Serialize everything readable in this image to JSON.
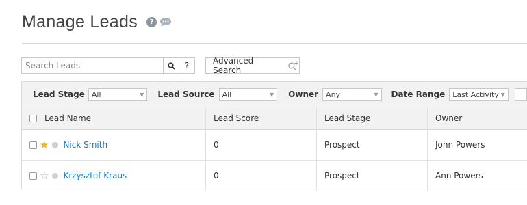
{
  "header": {
    "title": "Manage Leads",
    "help_glyph": "?"
  },
  "search": {
    "placeholder": "Search Leads",
    "value": "",
    "help_label": "?"
  },
  "advanced_search": {
    "label": "Advanced Search"
  },
  "filters": [
    {
      "label": "Lead Stage",
      "value": "All"
    },
    {
      "label": "Lead Source",
      "value": "All"
    },
    {
      "label": "Owner",
      "value": "Any"
    },
    {
      "label": "Date Range",
      "value": "Last Activity"
    }
  ],
  "table": {
    "columns": [
      "Lead Name",
      "Lead Score",
      "Lead Stage",
      "Owner"
    ],
    "rows": [
      {
        "name": "Nick Smith",
        "starred": true,
        "score": "0",
        "stage": "Prospect",
        "owner": "John Powers"
      },
      {
        "name": "Krzysztof Kraus",
        "starred": false,
        "score": "0",
        "stage": "Prospect",
        "owner": "Ann Powers"
      }
    ]
  },
  "icons": {
    "help": "help-icon",
    "chat": "chat-bubble-icon",
    "search": "search-icon",
    "advanced_search": "zoom-plus-icon",
    "star_filled": "star-filled-icon",
    "star_empty": "star-outline-icon",
    "status": "status-dot-icon",
    "dropdown": "chevron-down-icon"
  },
  "colors": {
    "link": "#1b7bc2",
    "star": "#f0b420",
    "bar_bg": "#f2f2f2"
  }
}
